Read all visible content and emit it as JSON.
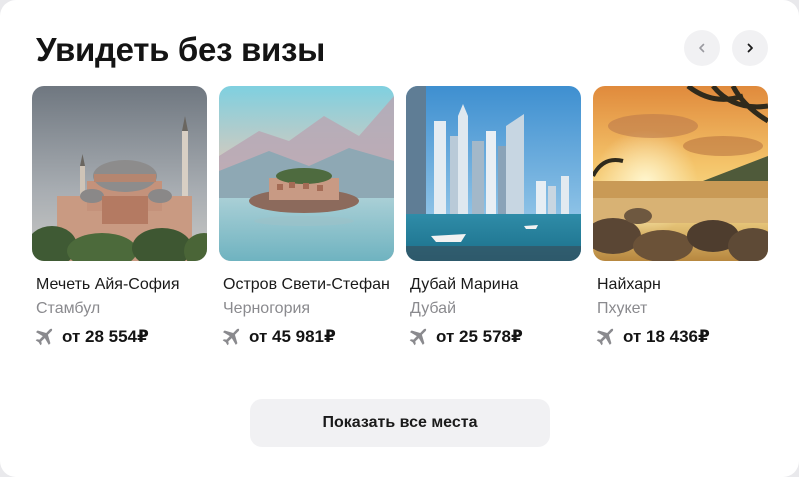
{
  "widget": {
    "title": "Увидеть без визы",
    "nav": {
      "prev_icon": "chevron-left-icon",
      "next_icon": "chevron-right-icon"
    },
    "show_all_label": "Показать все места"
  },
  "places": [
    {
      "name": "Мечеть Айя-София",
      "city": "Стамбул",
      "price": "от 28 554₽",
      "transport_icon": "plane-icon",
      "image": "hagia-sophia-photo"
    },
    {
      "name": "Остров Свети-Стефан",
      "city": "Черногория",
      "price": "от 45 981₽",
      "transport_icon": "plane-icon",
      "image": "sveti-stefan-photo"
    },
    {
      "name": "Дубай Марина",
      "city": "Дубай",
      "price": "от 25 578₽",
      "transport_icon": "plane-icon",
      "image": "dubai-marina-photo"
    },
    {
      "name": "Найхарн",
      "city": "Пхукет",
      "price": "от 18 436₽",
      "transport_icon": "plane-icon",
      "image": "nai-harn-beach-photo"
    }
  ],
  "colors": {
    "background": "#ffffff",
    "button_bg": "#f1f1f3",
    "secondary_text": "#8a8a8e",
    "icon": "#8a8a8e"
  }
}
